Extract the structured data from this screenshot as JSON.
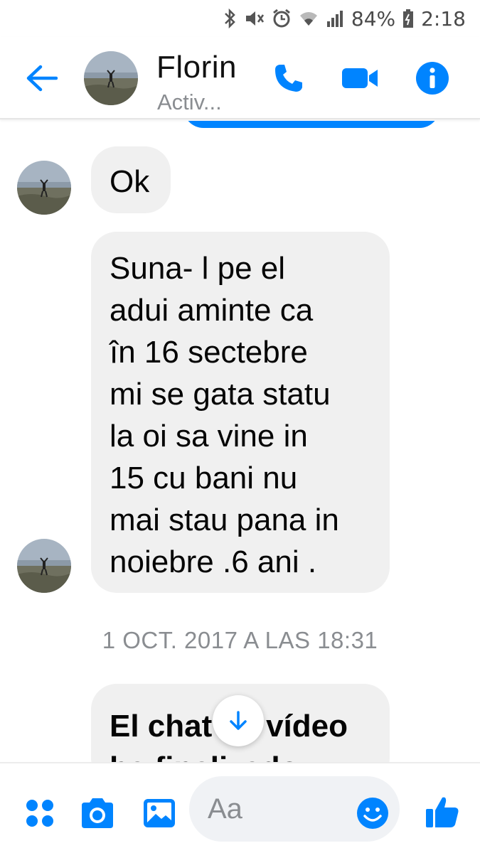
{
  "status_bar": {
    "battery": "84%",
    "time": "2:18"
  },
  "header": {
    "contact_name": "Florin",
    "contact_status": "Activ..."
  },
  "messages": [
    {
      "sender": "Florin",
      "text": "Ok"
    },
    {
      "sender": "Florin",
      "text": "Suna- l pe el\nadui aminte ca\nîn 16 sectebre\nmi se gata statu\nla oi sa vine in\n15 cu bani nu\nmai stau pana in\nnoiebre .6 ani ."
    }
  ],
  "timestamp": "1 OCT. 2017 A LAS 18:31",
  "system_message": "El chat de vídeo\nha finalizado",
  "composer": {
    "placeholder": "Aa"
  },
  "colors": {
    "accent": "#0084ff",
    "bubble_received": "#f0f0f0",
    "muted_text": "#8a8d91"
  },
  "icons": {
    "back": "arrow-left-icon",
    "call": "phone-icon",
    "video": "video-camera-icon",
    "info": "info-icon",
    "more": "four-dots-icon",
    "camera": "camera-icon",
    "gallery": "image-icon",
    "emoji": "smiley-icon",
    "like": "thumbs-up-icon",
    "scroll": "arrow-down-icon"
  }
}
